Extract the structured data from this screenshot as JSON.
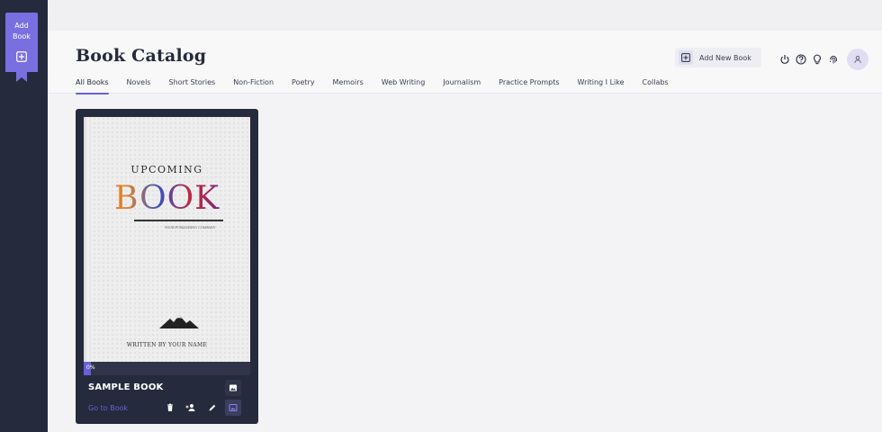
{
  "sidebar": {
    "add_book_label": "Add Book"
  },
  "header": {
    "title": "Book Catalog",
    "add_new_label": "Add New Book",
    "tabs": [
      {
        "label": "All Books",
        "active": true
      },
      {
        "label": "Novels",
        "active": false
      },
      {
        "label": "Short Stories",
        "active": false
      },
      {
        "label": "Non-Fiction",
        "active": false
      },
      {
        "label": "Poetry",
        "active": false
      },
      {
        "label": "Memoirs",
        "active": false
      },
      {
        "label": "Web Writing",
        "active": false
      },
      {
        "label": "Journalism",
        "active": false
      },
      {
        "label": "Practice Prompts",
        "active": false
      },
      {
        "label": "Writing I Like",
        "active": false
      },
      {
        "label": "Collabs",
        "active": false
      }
    ],
    "icons": [
      "power-icon",
      "help-icon",
      "lightbulb-icon",
      "fingerprint-icon",
      "user-icon"
    ]
  },
  "book": {
    "title": "SAMPLE BOOK",
    "goto_label": "Go to Book",
    "progress_percent": 0,
    "progress_label": "0%",
    "cover": {
      "line1": "UPCOMING",
      "line2": "BOOK",
      "publisher": "YOUR PUBLISHING COMPANY",
      "author": "WRITTEN BY YOUR NAME"
    }
  },
  "colors": {
    "accent": "#6a5fd8",
    "sidebar": "#262a3d",
    "card": "#262a3d"
  }
}
